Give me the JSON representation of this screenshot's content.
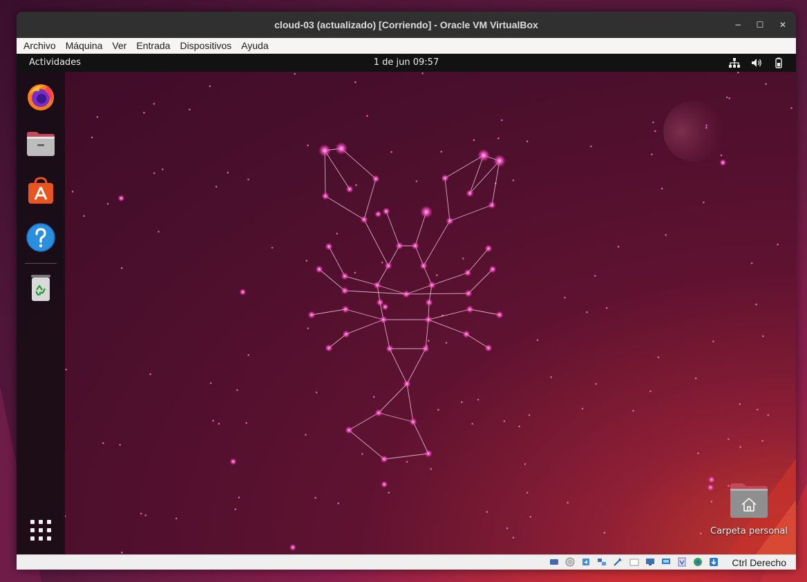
{
  "window": {
    "title": "cloud-03 (actualizado) [Corriendo] - Oracle VM VirtualBox",
    "controls": {
      "minimize": "−",
      "maximize": "☐",
      "close": "✕"
    }
  },
  "menubar": {
    "items": [
      "Archivo",
      "Máquina",
      "Ver",
      "Entrada",
      "Dispositivos",
      "Ayuda"
    ]
  },
  "guest": {
    "topbar": {
      "activities": "Actividades",
      "clock": "1 de jun  09:57",
      "tray_icons": [
        "network-icon",
        "volume-icon",
        "battery-icon"
      ]
    },
    "dock": {
      "apps": [
        {
          "name": "Firefox",
          "icon": "firefox-icon"
        },
        {
          "name": "Archivos",
          "icon": "files-icon"
        },
        {
          "name": "Ubuntu Software",
          "icon": "software-store-icon"
        },
        {
          "name": "Ayuda",
          "icon": "help-icon"
        },
        {
          "name": "Papelera",
          "icon": "trash-icon"
        }
      ],
      "show_apps_icon": "app-grid-icon"
    },
    "desktop_icons": [
      {
        "label": "Carpeta personal",
        "icon": "home-folder-icon"
      }
    ]
  },
  "statusbar": {
    "icons": [
      "hard-disk-icon",
      "optical-drive-icon",
      "audio-icon",
      "network-icon",
      "usb-icon",
      "shared-folders-icon",
      "display-icon",
      "video-capture-icon",
      "recording-icon",
      "cpu-icon",
      "mouse-integration-icon"
    ],
    "host_key": "Ctrl Derecho"
  },
  "colors": {
    "accent_orange": "#e95420",
    "wallpaper_dark": "#3e0c28",
    "wallpaper_glow": "#c93a2a",
    "star_pink": "#ff6ad5"
  }
}
